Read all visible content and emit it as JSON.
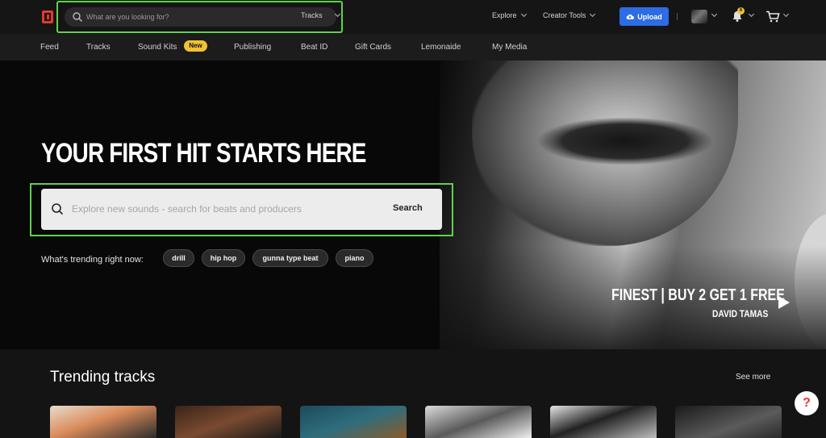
{
  "header": {
    "search_placeholder": "What are you looking for?",
    "search_category": "Tracks",
    "explore": "Explore",
    "creator_tools": "Creator Tools",
    "upload": "Upload",
    "notification_count": "6",
    "logo_icon": "beatstars-logo-icon",
    "bell_icon": "bell-icon",
    "cart_icon": "cart-icon"
  },
  "subnav": {
    "items": [
      "Feed",
      "Tracks",
      "Sound Kits",
      "Publishing",
      "Beat ID",
      "Gift Cards",
      "Lemonaide",
      "My Media"
    ],
    "new_badge": "New"
  },
  "hero": {
    "title": "YOUR FIRST HIT STARTS HERE",
    "search_placeholder": "Explore new sounds - search for beats and producers",
    "search_button": "Search",
    "trending_label": "What's trending right now:",
    "chips": [
      "drill",
      "hip hop",
      "gunna type beat",
      "piano"
    ],
    "promo_title": "FINEST | BUY 2 GET 1 FREE",
    "promo_subtitle": "DAVID TAMAS"
  },
  "trending": {
    "title": "Trending tracks",
    "see_more": "See more"
  },
  "help": {
    "label": "?"
  },
  "colors": {
    "accent_blue": "#2c6ce4",
    "badge_yellow": "#f1c232",
    "brand_red": "#e23b2e",
    "highlight_green": "#5fd24a"
  }
}
